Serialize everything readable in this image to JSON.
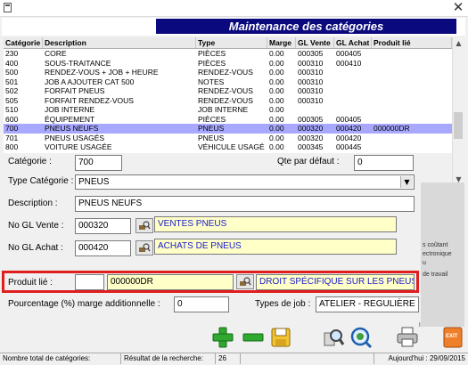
{
  "window": {
    "close_glyph": "✕"
  },
  "header": {
    "title": "Maintenance des catégories"
  },
  "table": {
    "columns": [
      "Catégorie",
      "Description",
      "Type",
      "Marge",
      "GL Vente",
      "GL Achat",
      "Produit lié"
    ],
    "rows": [
      [
        "230",
        "CORE",
        "PIÈCES",
        "0.00",
        "000305",
        "000405",
        ""
      ],
      [
        "400",
        "SOUS-TRAITANCE",
        "PIÈCES",
        "0.00",
        "000310",
        "000410",
        ""
      ],
      [
        "500",
        "RENDEZ-VOUS + JOB + HEURE",
        "RENDEZ-VOUS",
        "0.00",
        "000310",
        "",
        ""
      ],
      [
        "501",
        "JOB A AJOUTER CAT 500",
        "NOTES",
        "0.00",
        "000310",
        "",
        ""
      ],
      [
        "502",
        "FORFAIT PNEUS",
        "RENDEZ-VOUS",
        "0.00",
        "000310",
        "",
        ""
      ],
      [
        "505",
        "FORFAIT RENDEZ-VOUS",
        "RENDEZ-VOUS",
        "0.00",
        "000310",
        "",
        ""
      ],
      [
        "510",
        "JOB INTERNE",
        "JOB INTERNE",
        "0.00",
        "",
        "",
        ""
      ],
      [
        "600",
        "ÉQUIPEMENT",
        "PIÈCES",
        "0.00",
        "000305",
        "000405",
        ""
      ],
      [
        "700",
        "PNEUS NEUFS",
        "PNEUS",
        "0.00",
        "000320",
        "000420",
        "000000DR"
      ],
      [
        "701",
        "PNEUS USAGÉS",
        "PNEUS",
        "0.00",
        "000320",
        "000420",
        ""
      ],
      [
        "800",
        "VOITURE USAGÉE",
        "VÉHICULE USAGÉ",
        "0.00",
        "000345",
        "000445",
        ""
      ]
    ],
    "selected_index": 8
  },
  "form": {
    "categorie_label": "Catégorie :",
    "categorie_value": "700",
    "qte_label": "Qte par défaut :",
    "qte_value": "0",
    "type_label": "Type Catégorie :",
    "type_value": "PNEUS",
    "description_label": "Description :",
    "description_value": "PNEUS NEUFS",
    "gl_vente_label": "No GL Vente :",
    "gl_vente_value": "000320",
    "gl_vente_desc": "VENTES PNEUS",
    "gl_achat_label": "No GL Achat :",
    "gl_achat_value": "000420",
    "gl_achat_desc": "ACHATS DE PNEUS",
    "produit_label": "Produit lié :",
    "produit_prefix": "",
    "produit_value": "000000DR",
    "produit_desc": "DROIT SPÉCIFIQUE SUR LES PNEUS",
    "marge_label": "Pourcentage (%) marge additionnelle :",
    "marge_value": "0",
    "job_label": "Types de job :",
    "job_value": "ATELIER - REGULIÈRE"
  },
  "right_panel": {
    "lines": [
      "s coûtant",
      "ectronique",
      "u",
      "de travail"
    ]
  },
  "toolbar": {
    "icons": [
      "add-icon",
      "remove-icon",
      "save-icon",
      "search-icon",
      "refresh-search-icon",
      "print-icon",
      "exit-icon"
    ],
    "exit_label": "EXIT"
  },
  "status": {
    "total_label": "Nombre total de catégories:",
    "result_label": "Résultat de la recherche:",
    "result_value": "26",
    "today": "Aujourd'hui : 29/09/2015"
  },
  "colors": {
    "header_bg": "#0a0a7e",
    "selected_row": "#a8a8ff",
    "highlight_border": "#e01e1e",
    "link_text": "#1a1ad0",
    "lookup_bg": "#ffffc8"
  }
}
